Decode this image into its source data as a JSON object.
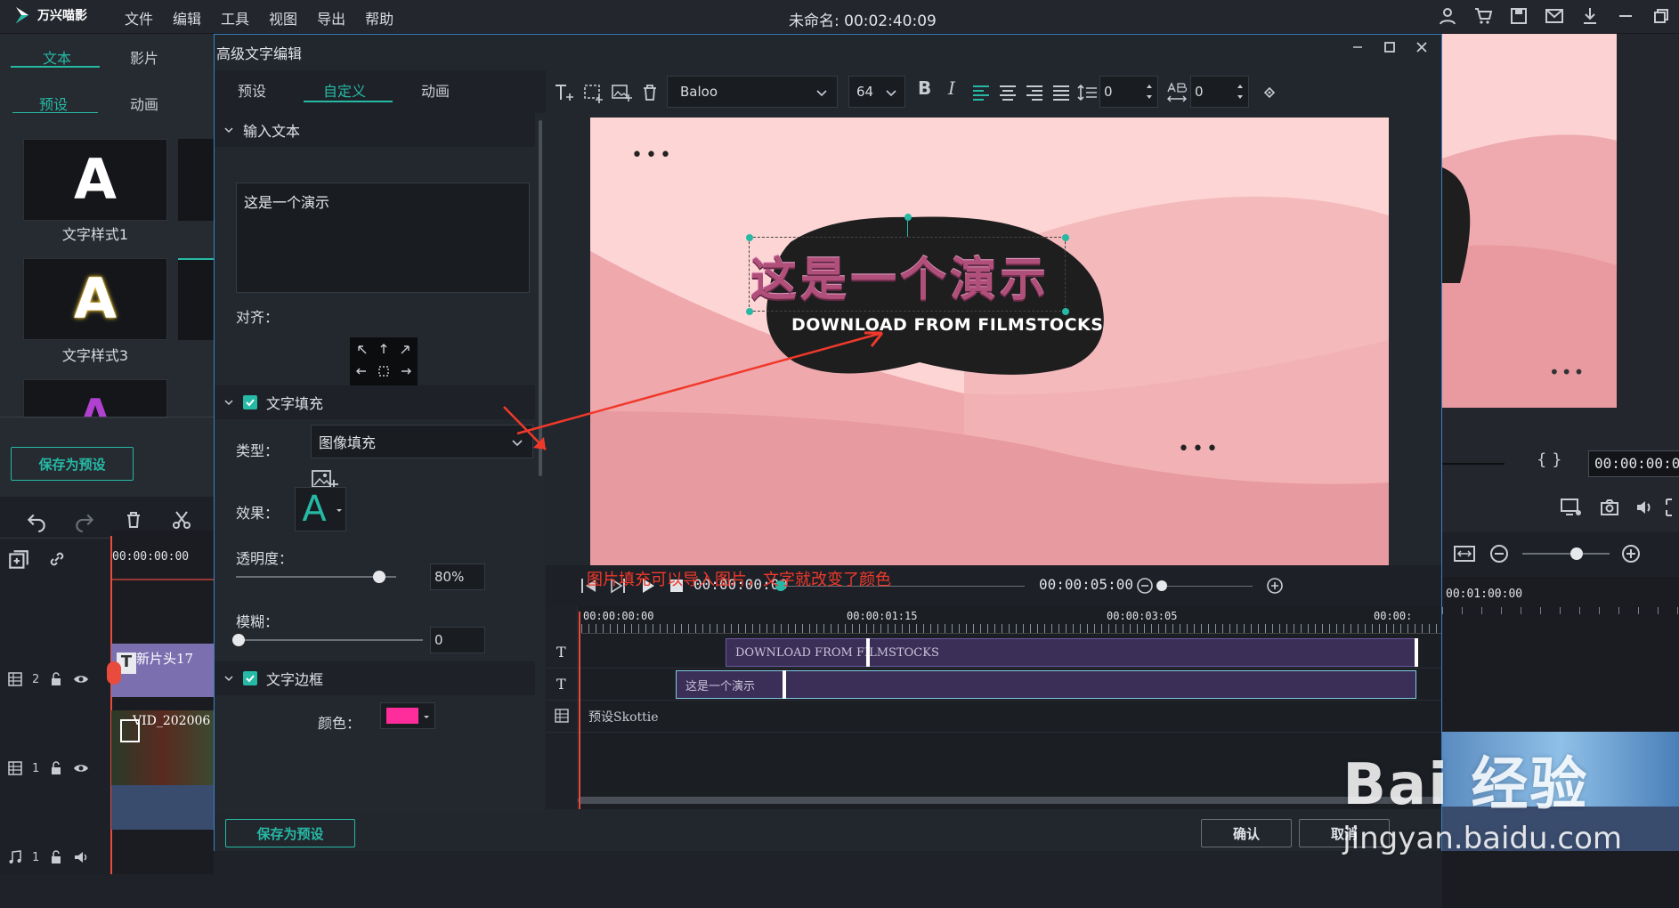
{
  "app": {
    "name": "万兴喵影",
    "project_title": "未命名: 00:02:40:09"
  },
  "menu": [
    "文件",
    "编辑",
    "工具",
    "视图",
    "导出",
    "帮助"
  ],
  "media_panel": {
    "tabs": [
      "文本",
      "影片"
    ],
    "subtabs": [
      "预设",
      "动画"
    ],
    "styles": [
      {
        "glyph": "A",
        "label": "文字样式1"
      },
      {
        "glyph": "A",
        "label": "文字样式3"
      },
      {
        "glyph": "A",
        "label": ""
      }
    ],
    "save_preset": "保存为预设"
  },
  "timeline_left": {
    "time": "00:00:00:00",
    "tracks": [
      {
        "label": "2",
        "clip": "新片头17"
      },
      {
        "label": "1",
        "clip": "VID_202006"
      },
      {
        "label": "1",
        "clip": ""
      }
    ]
  },
  "right_panel": {
    "timecode": "00:00:00:0",
    "ruler_time": "00:01:00:00",
    "braces": "{ }"
  },
  "dialog": {
    "title": "高级文字编辑",
    "tabs": [
      "预设",
      "自定义",
      "动画"
    ],
    "input_section": "输入文本",
    "input_text": "这是一个演示",
    "align_label": "对齐：",
    "fill_section": "文字填充",
    "type_label": "类型：",
    "type_value": "图像填充",
    "effect_label": "效果：",
    "effect_glyph": "A",
    "opacity_label": "透明度：",
    "opacity_value": "80%",
    "opacity": 0.8,
    "blur_label": "模糊：",
    "blur_value": "0",
    "blur": 0,
    "border_section": "文字边框",
    "color_label": "颜色：",
    "border_color": "#ff2d9b",
    "save_preset": "保存为预设",
    "confirm": "确认",
    "cancel": "取消"
  },
  "toolbar": {
    "font": "Baloo",
    "size": "64",
    "spacing1": "0",
    "spacing2": "0"
  },
  "canvas": {
    "main_text": "这是一个演示",
    "sub_text": "DOWNLOAD FROM FILMSTOCKS",
    "dots": "•••"
  },
  "player": {
    "current": "00:00:00:00",
    "duration": "00:00:05:00"
  },
  "dialog_timeline": {
    "ruler": [
      "00:00:00:00",
      "00:00:01:15",
      "00:00:03:05",
      "00:00:"
    ],
    "tracks": [
      {
        "icon": "T",
        "clip": "DOWNLOAD FROM FILMSTOCKS"
      },
      {
        "icon": "T",
        "clip": "这是一个演示"
      },
      {
        "icon": "grid",
        "clip": "预设Skottie"
      }
    ]
  },
  "annotation": "图片填充可以导入图片，文字就改变了颜色",
  "watermark": {
    "brand": "Bai  经验",
    "url": "jingyan.baidu.com"
  },
  "colors": {
    "accent": "#26b9a5",
    "arrow": "#f0392b",
    "canvas_bg": "#fdd5d4",
    "clip": "#3b2f58"
  }
}
